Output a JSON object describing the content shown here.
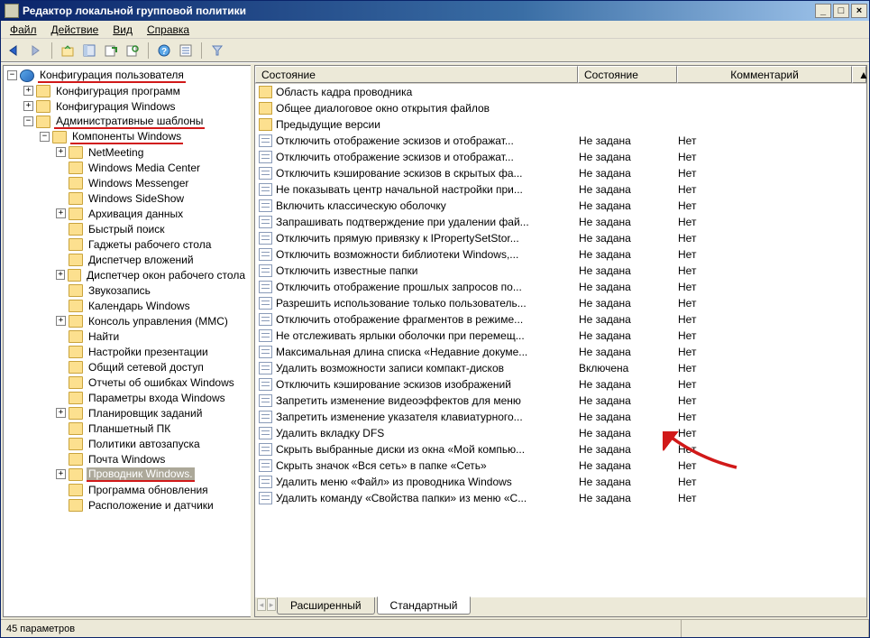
{
  "window": {
    "title": "Редактор локальной групповой политики"
  },
  "window_buttons": {
    "min": "_",
    "max": "□",
    "close": "×"
  },
  "menu": {
    "file": "Файл",
    "action": "Действие",
    "view": "Вид",
    "help": "Справка"
  },
  "columns": {
    "name": "Состояние",
    "state": "Состояние",
    "comment": "Комментарий"
  },
  "tabs": {
    "ext": "Расширенный",
    "std": "Стандартный"
  },
  "status": {
    "text": "45 параметров"
  },
  "tree": [
    {
      "indent": 0,
      "exp": "-",
      "icon": "user",
      "label": "Конфигурация пользователя",
      "red": true
    },
    {
      "indent": 1,
      "exp": "+",
      "icon": "folder",
      "label": "Конфигурация программ"
    },
    {
      "indent": 1,
      "exp": "+",
      "icon": "folder",
      "label": "Конфигурация Windows"
    },
    {
      "indent": 1,
      "exp": "-",
      "icon": "folder",
      "label": "Административные шаблоны",
      "red": true
    },
    {
      "indent": 2,
      "exp": "-",
      "icon": "folder",
      "label": "Компоненты Windows",
      "red": true
    },
    {
      "indent": 3,
      "exp": "+",
      "icon": "folder",
      "label": "NetMeeting"
    },
    {
      "indent": 3,
      "exp": "",
      "icon": "folder",
      "label": "Windows Media Center"
    },
    {
      "indent": 3,
      "exp": "",
      "icon": "folder",
      "label": "Windows Messenger"
    },
    {
      "indent": 3,
      "exp": "",
      "icon": "folder",
      "label": "Windows SideShow"
    },
    {
      "indent": 3,
      "exp": "+",
      "icon": "folder",
      "label": "Архивация данных"
    },
    {
      "indent": 3,
      "exp": "",
      "icon": "folder",
      "label": "Быстрый поиск"
    },
    {
      "indent": 3,
      "exp": "",
      "icon": "folder",
      "label": "Гаджеты рабочего стола"
    },
    {
      "indent": 3,
      "exp": "",
      "icon": "folder",
      "label": "Диспетчер вложений"
    },
    {
      "indent": 3,
      "exp": "+",
      "icon": "folder",
      "label": "Диспетчер окон рабочего стола"
    },
    {
      "indent": 3,
      "exp": "",
      "icon": "folder",
      "label": "Звукозапись"
    },
    {
      "indent": 3,
      "exp": "",
      "icon": "folder",
      "label": "Календарь Windows"
    },
    {
      "indent": 3,
      "exp": "+",
      "icon": "folder",
      "label": "Консоль управления (ММС)"
    },
    {
      "indent": 3,
      "exp": "",
      "icon": "folder",
      "label": "Найти"
    },
    {
      "indent": 3,
      "exp": "",
      "icon": "folder",
      "label": "Настройки презентации"
    },
    {
      "indent": 3,
      "exp": "",
      "icon": "folder",
      "label": "Общий сетевой доступ"
    },
    {
      "indent": 3,
      "exp": "",
      "icon": "folder",
      "label": "Отчеты об ошибках Windows"
    },
    {
      "indent": 3,
      "exp": "",
      "icon": "folder",
      "label": "Параметры входа Windows"
    },
    {
      "indent": 3,
      "exp": "+",
      "icon": "folder",
      "label": "Планировщик заданий"
    },
    {
      "indent": 3,
      "exp": "",
      "icon": "folder",
      "label": "Планшетный ПК"
    },
    {
      "indent": 3,
      "exp": "",
      "icon": "folder",
      "label": "Политики автозапуска"
    },
    {
      "indent": 3,
      "exp": "",
      "icon": "folder",
      "label": "Почта Windows"
    },
    {
      "indent": 3,
      "exp": "+",
      "icon": "folder",
      "label": "Проводник Windows.",
      "red": true,
      "selected": true
    },
    {
      "indent": 3,
      "exp": "",
      "icon": "folder",
      "label": "Программа обновления"
    },
    {
      "indent": 3,
      "exp": "",
      "icon": "folder",
      "label": "Расположение и датчики"
    }
  ],
  "list": [
    {
      "type": "folder",
      "name": "Область кадра проводника",
      "state": "",
      "comment": ""
    },
    {
      "type": "folder",
      "name": "Общее диалоговое окно открытия файлов",
      "state": "",
      "comment": ""
    },
    {
      "type": "folder",
      "name": "Предыдущие версии",
      "state": "",
      "comment": ""
    },
    {
      "type": "policy",
      "name": "Отключить отображение эскизов и отображат...",
      "state": "Не задана",
      "comment": "Нет"
    },
    {
      "type": "policy",
      "name": "Отключить отображение эскизов и отображат...",
      "state": "Не задана",
      "comment": "Нет"
    },
    {
      "type": "policy",
      "name": "Отключить кэширование эскизов в скрытых фа...",
      "state": "Не задана",
      "comment": "Нет"
    },
    {
      "type": "policy",
      "name": "Не показывать центр начальной настройки при...",
      "state": "Не задана",
      "comment": "Нет"
    },
    {
      "type": "policy",
      "name": "Включить классическую оболочку",
      "state": "Не задана",
      "comment": "Нет"
    },
    {
      "type": "policy",
      "name": "Запрашивать подтверждение при удалении фай...",
      "state": "Не задана",
      "comment": "Нет"
    },
    {
      "type": "policy",
      "name": "Отключить прямую привязку к IPropertySetStor...",
      "state": "Не задана",
      "comment": "Нет"
    },
    {
      "type": "policy",
      "name": "Отключить возможности библиотеки Windows,...",
      "state": "Не задана",
      "comment": "Нет"
    },
    {
      "type": "policy",
      "name": "Отключить известные папки",
      "state": "Не задана",
      "comment": "Нет"
    },
    {
      "type": "policy",
      "name": "Отключить отображение прошлых запросов по...",
      "state": "Не задана",
      "comment": "Нет"
    },
    {
      "type": "policy",
      "name": "Разрешить использование только пользователь...",
      "state": "Не задана",
      "comment": "Нет"
    },
    {
      "type": "policy",
      "name": "Отключить отображение фрагментов в режиме...",
      "state": "Не задана",
      "comment": "Нет"
    },
    {
      "type": "policy",
      "name": "Не отслеживать ярлыки оболочки при перемещ...",
      "state": "Не задана",
      "comment": "Нет"
    },
    {
      "type": "policy",
      "name": "Максимальная длина списка «Недавние докуме...",
      "state": "Не задана",
      "comment": "Нет"
    },
    {
      "type": "policy",
      "name": "Удалить возможности записи компакт-дисков",
      "state": "Включена",
      "comment": "Нет",
      "red": true
    },
    {
      "type": "policy",
      "name": "Отключить кэширование эскизов изображений",
      "state": "Не задана",
      "comment": "Нет"
    },
    {
      "type": "policy",
      "name": "Запретить изменение видеоэффектов для меню",
      "state": "Не задана",
      "comment": "Нет"
    },
    {
      "type": "policy",
      "name": "Запретить изменение указателя клавиатурного...",
      "state": "Не задана",
      "comment": "Нет"
    },
    {
      "type": "policy",
      "name": "Удалить вкладку DFS",
      "state": "Не задана",
      "comment": "Нет"
    },
    {
      "type": "policy",
      "name": "Скрыть выбранные диски из окна «Мой компью...",
      "state": "Не задана",
      "comment": "Нет"
    },
    {
      "type": "policy",
      "name": "Скрыть значок «Вся сеть» в папке «Сеть»",
      "state": "Не задана",
      "comment": "Нет"
    },
    {
      "type": "policy",
      "name": "Удалить меню «Файл» из проводника Windows",
      "state": "Не задана",
      "comment": "Нет"
    },
    {
      "type": "policy",
      "name": "Удалить команду «Свойства папки» из меню «С...",
      "state": "Не задана",
      "comment": "Нет"
    }
  ]
}
